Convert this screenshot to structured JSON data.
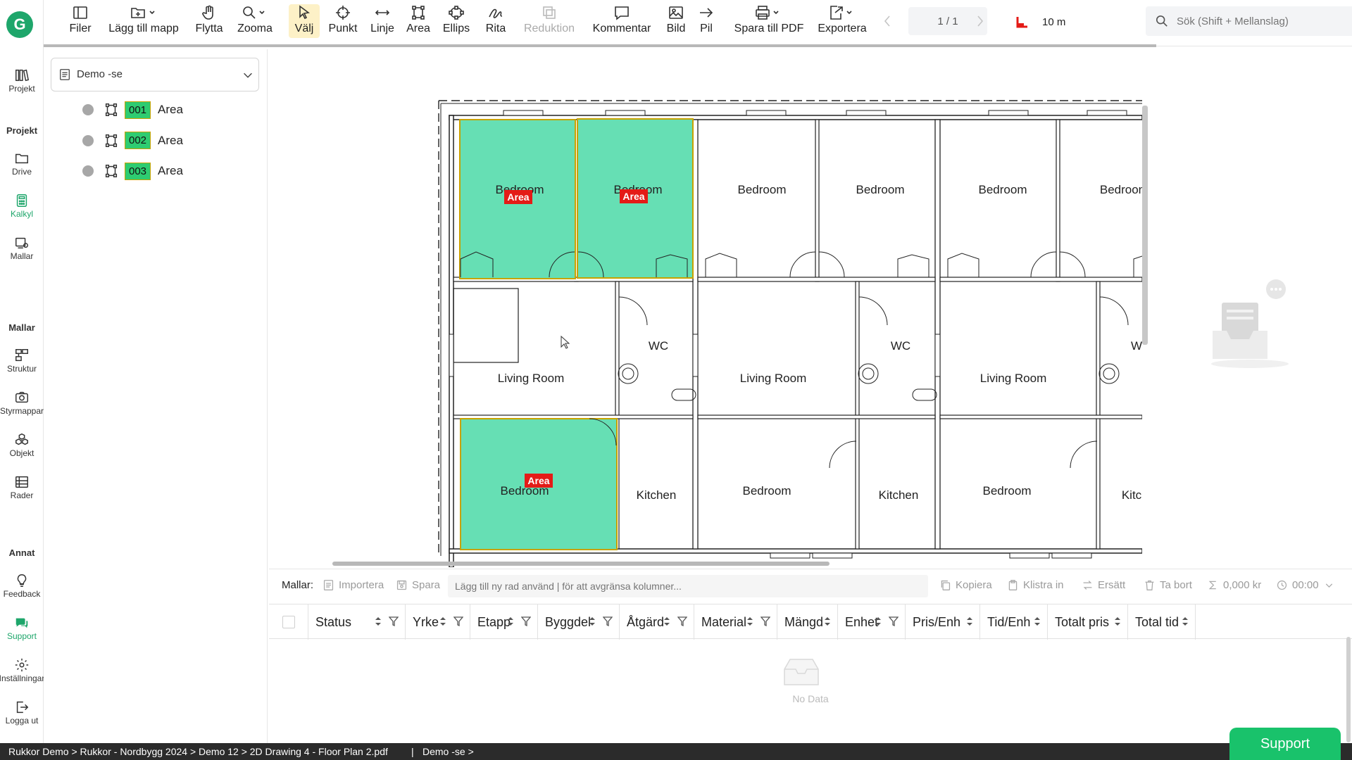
{
  "logo_letter": "G",
  "toolbar": {
    "files": "Filer",
    "add_folder": "Lägg till mapp",
    "move": "Flytta",
    "zoom": "Zooma",
    "select": "Välj",
    "point": "Punkt",
    "line": "Linje",
    "area": "Area",
    "ellipse": "Ellips",
    "draw": "Rita",
    "reduction": "Reduktion",
    "comment": "Kommentar",
    "image": "Bild",
    "arrow": "Pil",
    "save_pdf": "Spara till PDF",
    "export": "Exportera",
    "page_indicator": "1 / 1",
    "scale": "10 m",
    "search_placeholder": "Sök (Shift + Mellanslag)"
  },
  "nav": {
    "project": "Projekt",
    "section_project": "Projekt",
    "drive": "Drive",
    "calc": "Kalkyl",
    "templates": "Mallar",
    "section_templates": "Mallar",
    "structure": "Struktur",
    "folders": "Styrmappar",
    "objects": "Objekt",
    "rows": "Rader",
    "section_other": "Annat",
    "feedback": "Feedback",
    "support": "Support",
    "settings": "Inställningar",
    "logout": "Logga ut"
  },
  "panel": {
    "dropdown_value": "Demo -se",
    "layers": [
      {
        "code": "001",
        "label": "Area"
      },
      {
        "code": "002",
        "label": "Area"
      },
      {
        "code": "003",
        "label": "Area"
      }
    ]
  },
  "drawing": {
    "rooms": {
      "bedroom": "Bedroom",
      "living": "Living Room",
      "wc": "WC",
      "kitchen": "Kitchen",
      "bedroom_cut": "Bedroon",
      "kitchen_cut": "Kitc",
      "wc_cut": "W"
    },
    "area_tag": "Area"
  },
  "table": {
    "templates_label": "Mallar:",
    "import": "Importera",
    "save": "Spara",
    "input_placeholder": "Lägg till ny rad använd | för att avgränsa kolumner...",
    "copy": "Kopiera",
    "paste": "Klistra in",
    "replace": "Ersätt",
    "delete": "Ta bort",
    "total_price": "0,000 kr",
    "total_time": "00:00",
    "columns": [
      "Status",
      "Yrke",
      "Etapp",
      "Byggdel",
      "Åtgärd",
      "Material",
      "Mängd",
      "Enhet",
      "Pris/Enh",
      "Tid/Enh",
      "Totalt pris",
      "Total tid"
    ],
    "empty": "No Data"
  },
  "status_bar": {
    "breadcrumb": "Rukkor Demo > Rukkor - Nordbygg 2024 > Demo 12 > 2D Drawing 4 - Floor Plan 2.pdf",
    "separator": "|",
    "current": "Demo -se >"
  },
  "support_button": "Support",
  "colors": {
    "accent": "#19c26b",
    "area_fill": "#66dfb4",
    "area_stroke": "#c8a200",
    "area_tag": "#e41b17"
  }
}
